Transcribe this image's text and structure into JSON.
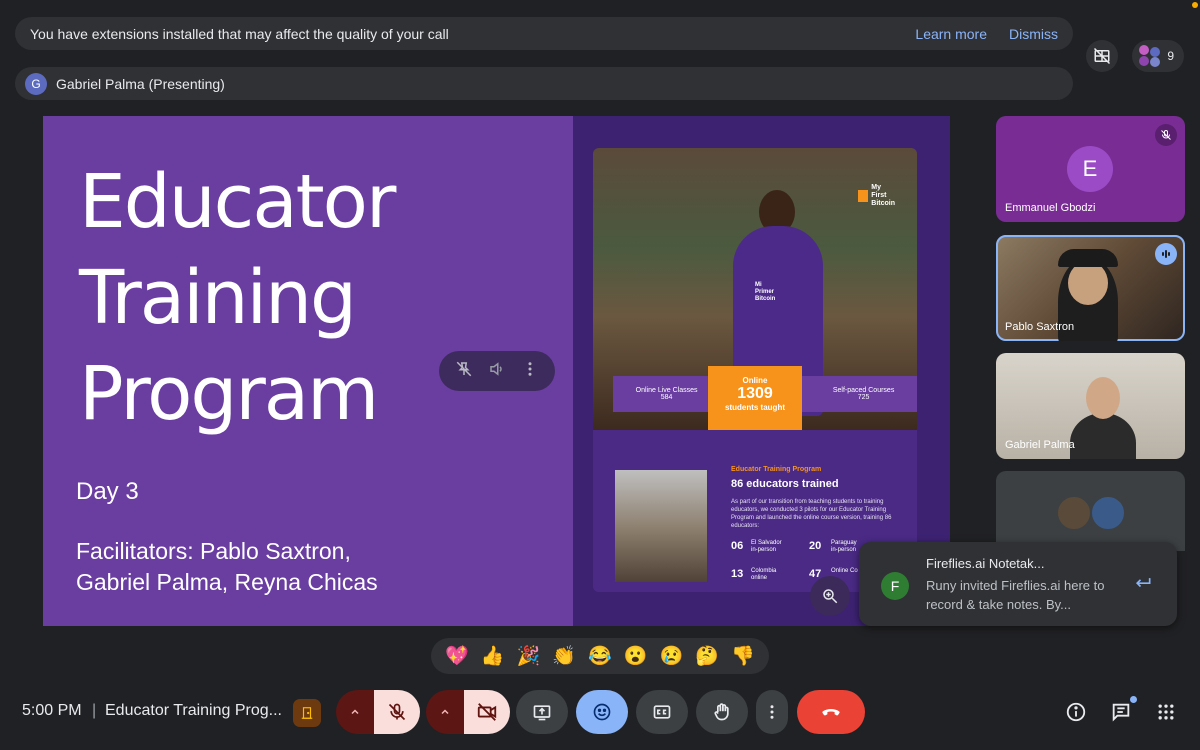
{
  "banner": {
    "message": "You have extensions installed that may affect the quality of your call",
    "learn_more": "Learn more",
    "dismiss": "Dismiss"
  },
  "presenting": {
    "avatar_letter": "G",
    "label": "Gabriel Palma (Presenting)"
  },
  "top_right": {
    "participant_count": "9"
  },
  "slide": {
    "title_lines": [
      "Educator",
      "Training",
      "Program"
    ],
    "day": "Day 3",
    "facilitators_line1": "Facilitators: Pablo Saxtron,",
    "facilitators_line2": "Gabriel Palma, Reyna Chicas",
    "card": {
      "logo_line1": "My",
      "logo_line2": "First",
      "logo_line3": "Bitcoin",
      "shirt_line1": "Mi",
      "shirt_line2": "Primer",
      "shirt_line3": "Bitcoin",
      "stat_left_label": "Online Live Classes",
      "stat_left_value": "584",
      "stat_center_label": "Online",
      "stat_center_value": "1309",
      "stat_center_sub": "students taught",
      "stat_right_label": "Self-paced Courses",
      "stat_right_value": "725",
      "section_label": "Educator Training Program",
      "section_title": "86 educators trained",
      "section_text": "As part of our transition from teaching students to training educators, we conducted 3 pilots for our Educator Training Program and launched the online course version, training 86 educators:",
      "rows": [
        {
          "num": "06",
          "place": "El Salvador",
          "mode": "in-person"
        },
        {
          "num": "20",
          "place": "Paraguay",
          "mode": "in-person"
        },
        {
          "num": "13",
          "place": "Colombia",
          "mode": "online"
        },
        {
          "num": "47",
          "place": "Online Co",
          "mode": ""
        }
      ]
    }
  },
  "tiles": [
    {
      "name": "Emmanuel Gbodzi",
      "avatar_letter": "E",
      "muted": true
    },
    {
      "name": "Pablo Saxtron",
      "speaking": true
    },
    {
      "name": "Gabriel Palma"
    },
    {
      "name": ""
    }
  ],
  "notification": {
    "avatar_letter": "F",
    "title": "Fireflies.ai Notetak...",
    "body": "Runy invited Fireflies.ai here to record & take notes. By..."
  },
  "reactions": [
    "💖",
    "👍",
    "🎉",
    "👏",
    "😂",
    "😮",
    "😢",
    "🤔",
    "👎"
  ],
  "bottom_bar": {
    "time": "5:00 PM",
    "separator": "|",
    "meeting_name": "Educator Training Prog..."
  },
  "colors": {
    "accent_blue": "#8ab4f8",
    "end_call_red": "#ea4335",
    "slide_purple": "#6a3ea1",
    "bitcoin_orange": "#f7931a"
  }
}
